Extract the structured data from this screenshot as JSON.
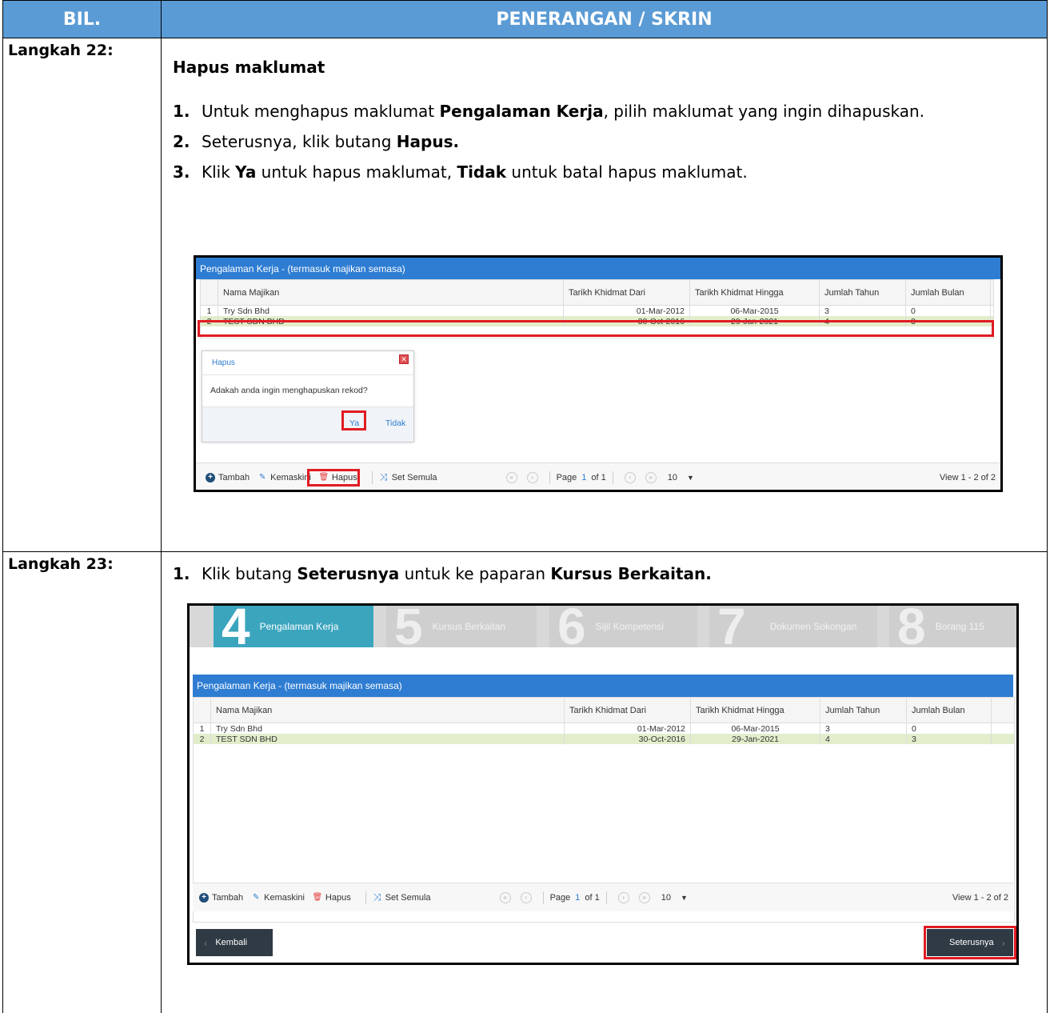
{
  "table_header": {
    "col1": "BIL.",
    "col2": "PENERANGAN / SKRIN"
  },
  "step22": {
    "label": "Langkah 22:",
    "heading": "Hapus maklumat",
    "items": [
      {
        "num": "1.",
        "pre": "Untuk menghapus maklumat ",
        "bold1": "Pengalaman Kerja",
        "post": ", pilih maklumat yang ingin dihapuskan."
      },
      {
        "num": "2.",
        "pre": "Seterusnya, klik butang ",
        "bold1": "Hapus.",
        "post": ""
      },
      {
        "num": "3.",
        "pre": "Klik ",
        "bold1": "Ya",
        "mid": " untuk hapus maklumat, ",
        "bold2": "Tidak",
        "post": " untuk batal hapus maklumat."
      }
    ]
  },
  "step23": {
    "label": "Langkah 23:",
    "items": [
      {
        "num": "1.",
        "pre": "Klik butang ",
        "bold1": "Seterusnya",
        "mid": " untuk ke paparan ",
        "bold2": "Kursus Berkaitan.",
        "post": ""
      }
    ]
  },
  "grid": {
    "title": "Pengalaman Kerja - (termasuk majikan semasa)",
    "columns": [
      "Nama Majikan",
      "Tarikh Khidmat Dari",
      "Tarikh Khidmat Hingga",
      "Jumlah Tahun",
      "Jumlah Bulan"
    ],
    "rows": [
      {
        "no": "1",
        "nama": "Try Sdn Bhd",
        "dari": "01-Mar-2012",
        "hingga": "06-Mar-2015",
        "tahun": "3",
        "bulan": "0"
      },
      {
        "no": "2",
        "nama": "TEST SDN BHD",
        "dari": "30-Oct-2016",
        "hingga": "29-Jan-2021",
        "tahun": "4",
        "bulan": "3"
      }
    ],
    "toolbar": {
      "tambah": "Tambah",
      "kemaskini": "Kemaskini",
      "hapus": "Hapus",
      "set_semula": "Set Semula"
    },
    "pager": {
      "page_label": "Page",
      "page": "1",
      "of": "of 1",
      "rows": "10",
      "view": "View 1 - 2 of 2"
    }
  },
  "dialog": {
    "title": "Hapus",
    "message": "Adakah anda ingin menghapuskan rekod?",
    "yes": "Ya",
    "no": "Tidak"
  },
  "wizard": {
    "steps": [
      {
        "num": "4",
        "label": "Pengalaman Kerja"
      },
      {
        "num": "5",
        "label": "Kursus Berkaitan"
      },
      {
        "num": "6",
        "label": "Sijil Kompetensi"
      },
      {
        "num": "7",
        "label": "Dokumen Sokongan"
      },
      {
        "num": "8",
        "label": "Borang 115"
      }
    ],
    "back": "Kembali",
    "next": "Seterusnya"
  },
  "colors": {
    "header_blue": "#5B9BD5",
    "grid_title_blue": "#2E7DD2",
    "selected_row": "#E2EDCB",
    "highlight_red": "#E11B22",
    "wizard_active": "#3BA5BE"
  }
}
